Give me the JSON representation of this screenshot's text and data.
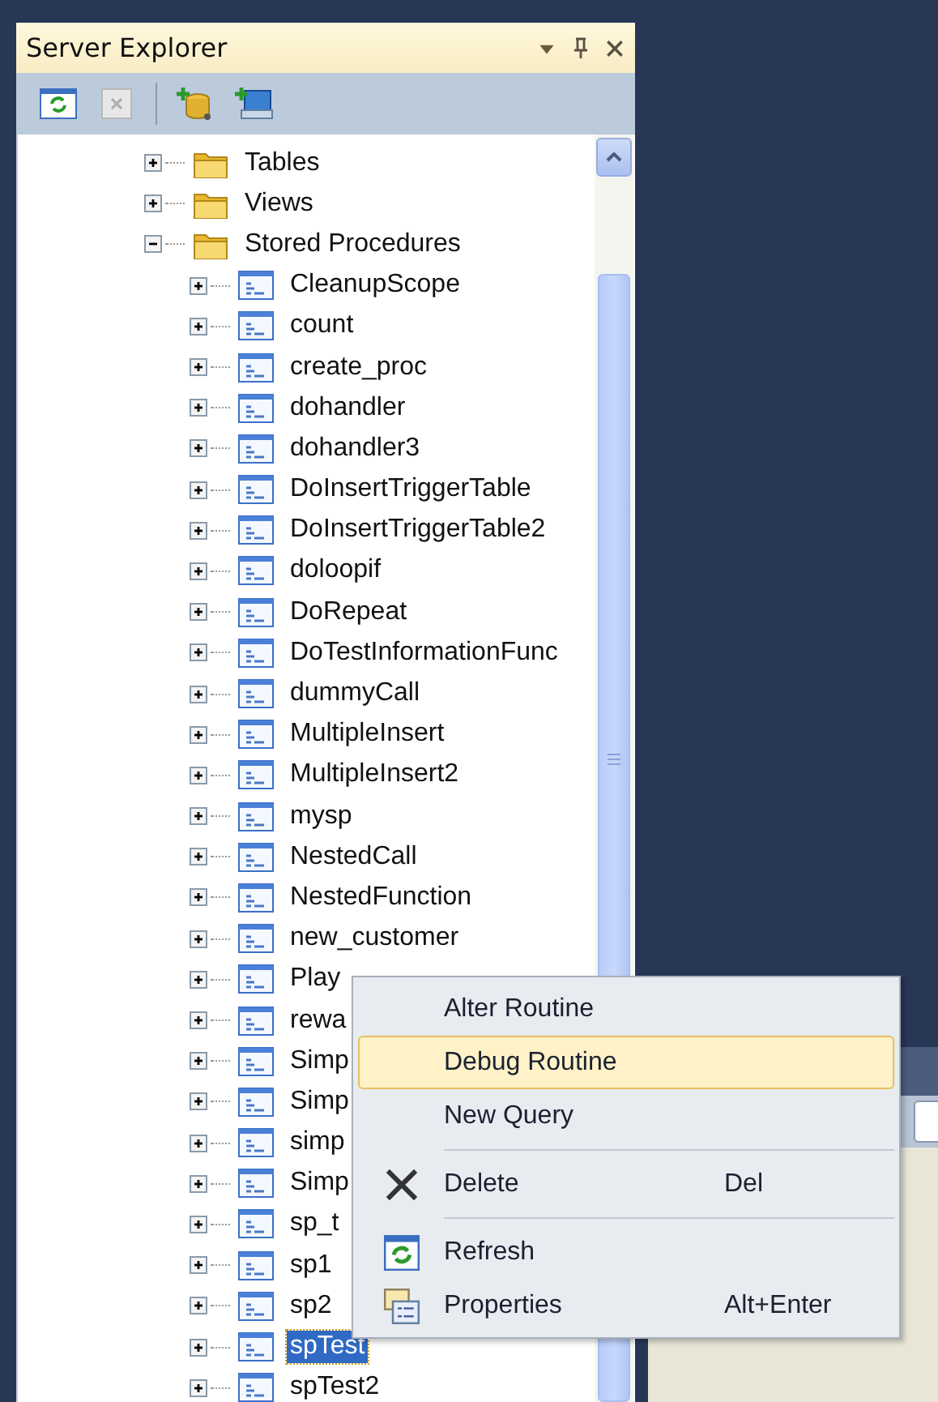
{
  "panel": {
    "title": "Server Explorer",
    "tree": [
      {
        "kind": "folder",
        "label": "Tables",
        "expanded": false,
        "selected": false
      },
      {
        "kind": "folder",
        "label": "Views",
        "expanded": false,
        "selected": false
      },
      {
        "kind": "folder",
        "label": "Stored Procedures",
        "expanded": true,
        "selected": false,
        "children": [
          {
            "kind": "procedure",
            "label": "CleanupScope",
            "expanded": false,
            "selected": false
          },
          {
            "kind": "procedure",
            "label": "count",
            "expanded": false,
            "selected": false
          },
          {
            "kind": "procedure",
            "label": "create_proc",
            "expanded": false,
            "selected": false
          },
          {
            "kind": "procedure",
            "label": "dohandler",
            "expanded": false,
            "selected": false
          },
          {
            "kind": "procedure",
            "label": "dohandler3",
            "expanded": false,
            "selected": false
          },
          {
            "kind": "procedure",
            "label": "DoInsertTriggerTable",
            "expanded": false,
            "selected": false
          },
          {
            "kind": "procedure",
            "label": "DoInsertTriggerTable2",
            "expanded": false,
            "selected": false
          },
          {
            "kind": "procedure",
            "label": "doloopif",
            "expanded": false,
            "selected": false
          },
          {
            "kind": "procedure",
            "label": "DoRepeat",
            "expanded": false,
            "selected": false
          },
          {
            "kind": "procedure",
            "label": "DoTestInformationFunc",
            "expanded": false,
            "selected": false
          },
          {
            "kind": "procedure",
            "label": "dummyCall",
            "expanded": false,
            "selected": false
          },
          {
            "kind": "procedure",
            "label": "MultipleInsert",
            "expanded": false,
            "selected": false
          },
          {
            "kind": "procedure",
            "label": "MultipleInsert2",
            "expanded": false,
            "selected": false
          },
          {
            "kind": "procedure",
            "label": "mysp",
            "expanded": false,
            "selected": false
          },
          {
            "kind": "procedure",
            "label": "NestedCall",
            "expanded": false,
            "selected": false
          },
          {
            "kind": "procedure",
            "label": "NestedFunction",
            "expanded": false,
            "selected": false
          },
          {
            "kind": "procedure",
            "label": "new_customer",
            "expanded": false,
            "selected": false
          },
          {
            "kind": "procedure",
            "label": "Play",
            "expanded": false,
            "selected": false
          },
          {
            "kind": "procedure",
            "label": "rewa",
            "expanded": false,
            "selected": false
          },
          {
            "kind": "procedure",
            "label": "Simp",
            "expanded": false,
            "selected": false
          },
          {
            "kind": "procedure",
            "label": "Simp",
            "expanded": false,
            "selected": false
          },
          {
            "kind": "procedure",
            "label": "simp",
            "expanded": false,
            "selected": false
          },
          {
            "kind": "procedure",
            "label": "Simp",
            "expanded": false,
            "selected": false
          },
          {
            "kind": "procedure",
            "label": "sp_t",
            "expanded": false,
            "selected": false
          },
          {
            "kind": "procedure",
            "label": "sp1",
            "expanded": false,
            "selected": false
          },
          {
            "kind": "procedure",
            "label": "sp2",
            "expanded": false,
            "selected": false
          },
          {
            "kind": "procedure",
            "label": "spTest",
            "expanded": false,
            "selected": true
          },
          {
            "kind": "procedure",
            "label": "spTest2",
            "expanded": false,
            "selected": false
          }
        ]
      }
    ]
  },
  "context_menu": {
    "items": [
      {
        "kind": "plain",
        "label": "Alter Routine",
        "highlighted": false
      },
      {
        "kind": "plain",
        "label": "Debug Routine",
        "highlighted": true
      },
      {
        "kind": "plain",
        "label": "New Query",
        "highlighted": false
      },
      {
        "kind": "separator"
      },
      {
        "kind": "delete",
        "label": "Delete",
        "shortcut": "Del",
        "highlighted": false
      },
      {
        "kind": "separator"
      },
      {
        "kind": "refresh",
        "label": "Refresh",
        "highlighted": false
      },
      {
        "kind": "properties",
        "label": "Properties",
        "shortcut": "Alt+Enter",
        "highlighted": false
      }
    ]
  }
}
